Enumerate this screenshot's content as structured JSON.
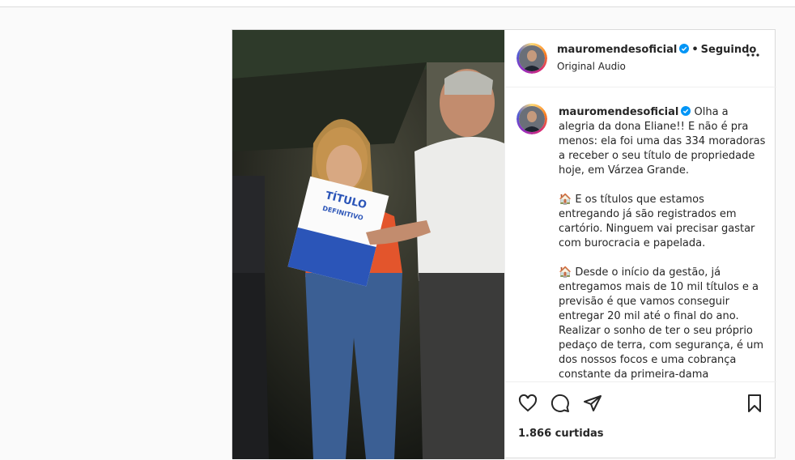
{
  "post": {
    "username": "mauromendesoficial",
    "follow_status": "Seguindo",
    "audio": "Original Audio",
    "caption_paragraphs": [
      "Olha a alegria da dona Eliane!! E não é pra menos: ela foi uma das 334 moradoras a receber o seu título de propriedade hoje, em Várzea Grande.",
      "🏠 E os títulos que estamos entregando já são registrados em cartório. Ninguem vai precisar gastar com burocracia e papelada.",
      "🏠 Desde o início da gestão, já entregamos mais de 10 mil títulos e a previsão é que vamos conseguir entregar 20 mil até o final do ano. Realizar o sonho de ter o seu próprio pedaço de terra, com segurança, é um dos nossos focos e uma cobrança constante da primeira-dama"
    ],
    "likes": "1.866 curtidas",
    "media_sign_title": "TÍTULO",
    "media_sign_subtitle": "DEFINITIVO"
  },
  "icons": [
    "verified-badge-icon",
    "more-options-icon",
    "heart-icon",
    "comment-icon",
    "share-icon",
    "bookmark-icon"
  ],
  "colors": {
    "verified": "#0095f6",
    "border": "#dbdbdb",
    "background": "#fafafa"
  }
}
